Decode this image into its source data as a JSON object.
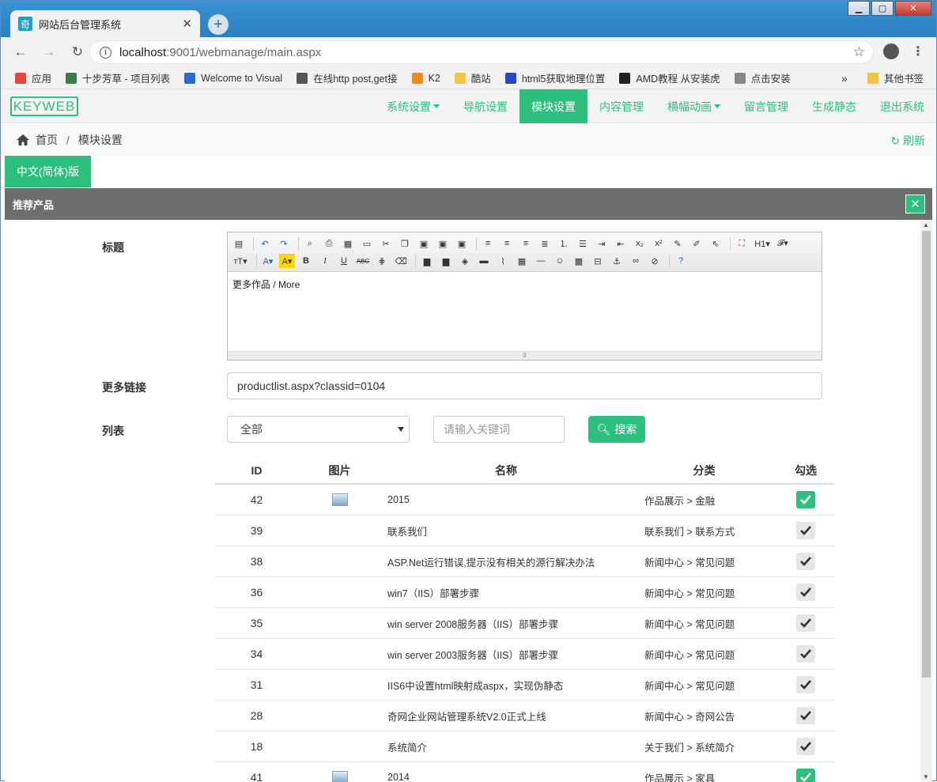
{
  "browser": {
    "tab_title": "网站后台管理系统",
    "tab_icon": "奇",
    "new_tab": "+",
    "url_host": "localhost",
    "url_path": ":9001/webmanage/main.aspx"
  },
  "bookmarks": [
    {
      "label": "应用",
      "color": "#e8453c"
    },
    {
      "label": "十步芳草 - 项目列表",
      "color": "#3a7d44"
    },
    {
      "label": "Welcome to Visual",
      "color": "#2b6cd4"
    },
    {
      "label": "在线http post,get接",
      "color": "#555555"
    },
    {
      "label": "K2",
      "color": "#f08a1c"
    },
    {
      "label": "酷站",
      "color": "#f4c542"
    },
    {
      "label": "html5获取地理位置",
      "color": "#2a46c9"
    },
    {
      "label": "AMD教程 从安装虎",
      "color": "#222222"
    },
    {
      "label": "点击安装",
      "color": "#888888"
    }
  ],
  "bookmarks_more": "»",
  "bookmarks_other": "其他书签",
  "app": {
    "logo": "KEYWEB",
    "nav": [
      {
        "label": "系统设置",
        "dropdown": true,
        "active": false
      },
      {
        "label": "导航设置",
        "dropdown": false,
        "active": false
      },
      {
        "label": "模块设置",
        "dropdown": false,
        "active": true
      },
      {
        "label": "内容管理",
        "dropdown": false,
        "active": false
      },
      {
        "label": "横幅动画",
        "dropdown": true,
        "active": false
      },
      {
        "label": "留言管理",
        "dropdown": false,
        "active": false
      },
      {
        "label": "生成静态",
        "dropdown": false,
        "active": false
      },
      {
        "label": "退出系统",
        "dropdown": false,
        "active": false
      }
    ],
    "breadcrumb": {
      "home": "首页",
      "sep": "/",
      "current": "模块设置"
    },
    "refresh": "刷新",
    "lang_button": "中文(简体)版",
    "panel_title": "推荐产品",
    "close": "✕"
  },
  "form": {
    "title_label": "标题",
    "editor_content": "更多作品 / More",
    "more_link_label": "更多链接",
    "more_link_value": "productlist.aspx?classid=0104",
    "list_label": "列表",
    "select_value": "全部",
    "keyword_placeholder": "请输入关键词",
    "search_button": "搜索"
  },
  "table": {
    "headers": [
      "ID",
      "图片",
      "名称",
      "分类",
      "勾选"
    ],
    "rows": [
      {
        "id": "42",
        "has_img": true,
        "name": "2015",
        "category": "作品展示 > 金融",
        "checked": true
      },
      {
        "id": "39",
        "has_img": false,
        "name": "联系我们",
        "category": "联系我们 > 联系方式",
        "checked": false
      },
      {
        "id": "38",
        "has_img": false,
        "name": "ASP.Net运行错误,提示没有相关的源行解决办法",
        "category": "新闻中心 > 常见问题",
        "checked": false
      },
      {
        "id": "36",
        "has_img": false,
        "name": "win7（IIS）部署步骤",
        "category": "新闻中心 > 常见问题",
        "checked": false
      },
      {
        "id": "35",
        "has_img": false,
        "name": "win server 2008服务器（IIS）部署步骤",
        "category": "新闻中心 > 常见问题",
        "checked": false
      },
      {
        "id": "34",
        "has_img": false,
        "name": "win server 2003服务器（IIS）部署步骤",
        "category": "新闻中心 > 常见问题",
        "checked": false
      },
      {
        "id": "31",
        "has_img": false,
        "name": "IIS6中设置html映射成aspx，实现伪静态",
        "category": "新闻中心 > 常见问题",
        "checked": false
      },
      {
        "id": "28",
        "has_img": false,
        "name": "奇网企业网站管理系统V2.0正式上线",
        "category": "新闻中心 > 奇网公告",
        "checked": false
      },
      {
        "id": "18",
        "has_img": false,
        "name": "系统简介",
        "category": "关于我们 > 系统简介",
        "checked": false
      },
      {
        "id": "41",
        "has_img": true,
        "name": "2014",
        "category": "作品展示 > 家具",
        "checked": true
      }
    ]
  },
  "colors": {
    "accent": "#2dbf7e",
    "panel_header": "#6e6e6e"
  }
}
